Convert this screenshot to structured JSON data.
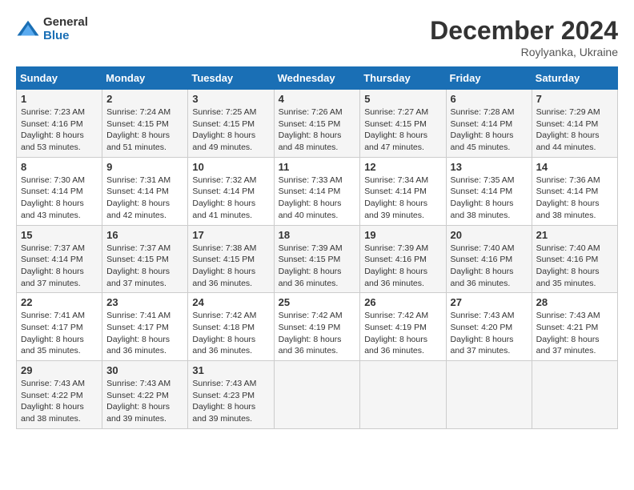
{
  "header": {
    "logo_general": "General",
    "logo_blue": "Blue",
    "title": "December 2024",
    "subtitle": "Roylyanka, Ukraine"
  },
  "weekdays": [
    "Sunday",
    "Monday",
    "Tuesday",
    "Wednesday",
    "Thursday",
    "Friday",
    "Saturday"
  ],
  "weeks": [
    [
      {
        "day": "1",
        "sunrise": "7:23 AM",
        "sunset": "4:16 PM",
        "daylight": "8 hours and 53 minutes."
      },
      {
        "day": "2",
        "sunrise": "7:24 AM",
        "sunset": "4:15 PM",
        "daylight": "8 hours and 51 minutes."
      },
      {
        "day": "3",
        "sunrise": "7:25 AM",
        "sunset": "4:15 PM",
        "daylight": "8 hours and 49 minutes."
      },
      {
        "day": "4",
        "sunrise": "7:26 AM",
        "sunset": "4:15 PM",
        "daylight": "8 hours and 48 minutes."
      },
      {
        "day": "5",
        "sunrise": "7:27 AM",
        "sunset": "4:15 PM",
        "daylight": "8 hours and 47 minutes."
      },
      {
        "day": "6",
        "sunrise": "7:28 AM",
        "sunset": "4:14 PM",
        "daylight": "8 hours and 45 minutes."
      },
      {
        "day": "7",
        "sunrise": "7:29 AM",
        "sunset": "4:14 PM",
        "daylight": "8 hours and 44 minutes."
      }
    ],
    [
      {
        "day": "8",
        "sunrise": "7:30 AM",
        "sunset": "4:14 PM",
        "daylight": "8 hours and 43 minutes."
      },
      {
        "day": "9",
        "sunrise": "7:31 AM",
        "sunset": "4:14 PM",
        "daylight": "8 hours and 42 minutes."
      },
      {
        "day": "10",
        "sunrise": "7:32 AM",
        "sunset": "4:14 PM",
        "daylight": "8 hours and 41 minutes."
      },
      {
        "day": "11",
        "sunrise": "7:33 AM",
        "sunset": "4:14 PM",
        "daylight": "8 hours and 40 minutes."
      },
      {
        "day": "12",
        "sunrise": "7:34 AM",
        "sunset": "4:14 PM",
        "daylight": "8 hours and 39 minutes."
      },
      {
        "day": "13",
        "sunrise": "7:35 AM",
        "sunset": "4:14 PM",
        "daylight": "8 hours and 38 minutes."
      },
      {
        "day": "14",
        "sunrise": "7:36 AM",
        "sunset": "4:14 PM",
        "daylight": "8 hours and 38 minutes."
      }
    ],
    [
      {
        "day": "15",
        "sunrise": "7:37 AM",
        "sunset": "4:14 PM",
        "daylight": "8 hours and 37 minutes."
      },
      {
        "day": "16",
        "sunrise": "7:37 AM",
        "sunset": "4:15 PM",
        "daylight": "8 hours and 37 minutes."
      },
      {
        "day": "17",
        "sunrise": "7:38 AM",
        "sunset": "4:15 PM",
        "daylight": "8 hours and 36 minutes."
      },
      {
        "day": "18",
        "sunrise": "7:39 AM",
        "sunset": "4:15 PM",
        "daylight": "8 hours and 36 minutes."
      },
      {
        "day": "19",
        "sunrise": "7:39 AM",
        "sunset": "4:16 PM",
        "daylight": "8 hours and 36 minutes."
      },
      {
        "day": "20",
        "sunrise": "7:40 AM",
        "sunset": "4:16 PM",
        "daylight": "8 hours and 36 minutes."
      },
      {
        "day": "21",
        "sunrise": "7:40 AM",
        "sunset": "4:16 PM",
        "daylight": "8 hours and 35 minutes."
      }
    ],
    [
      {
        "day": "22",
        "sunrise": "7:41 AM",
        "sunset": "4:17 PM",
        "daylight": "8 hours and 35 minutes."
      },
      {
        "day": "23",
        "sunrise": "7:41 AM",
        "sunset": "4:17 PM",
        "daylight": "8 hours and 36 minutes."
      },
      {
        "day": "24",
        "sunrise": "7:42 AM",
        "sunset": "4:18 PM",
        "daylight": "8 hours and 36 minutes."
      },
      {
        "day": "25",
        "sunrise": "7:42 AM",
        "sunset": "4:19 PM",
        "daylight": "8 hours and 36 minutes."
      },
      {
        "day": "26",
        "sunrise": "7:42 AM",
        "sunset": "4:19 PM",
        "daylight": "8 hours and 36 minutes."
      },
      {
        "day": "27",
        "sunrise": "7:43 AM",
        "sunset": "4:20 PM",
        "daylight": "8 hours and 37 minutes."
      },
      {
        "day": "28",
        "sunrise": "7:43 AM",
        "sunset": "4:21 PM",
        "daylight": "8 hours and 37 minutes."
      }
    ],
    [
      {
        "day": "29",
        "sunrise": "7:43 AM",
        "sunset": "4:22 PM",
        "daylight": "8 hours and 38 minutes."
      },
      {
        "day": "30",
        "sunrise": "7:43 AM",
        "sunset": "4:22 PM",
        "daylight": "8 hours and 39 minutes."
      },
      {
        "day": "31",
        "sunrise": "7:43 AM",
        "sunset": "4:23 PM",
        "daylight": "8 hours and 39 minutes."
      },
      null,
      null,
      null,
      null
    ]
  ]
}
